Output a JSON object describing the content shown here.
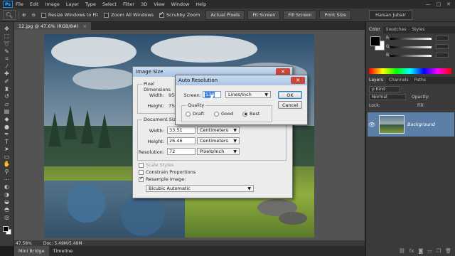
{
  "app": {
    "logo": "Ps"
  },
  "menu": [
    "File",
    "Edit",
    "Image",
    "Layer",
    "Type",
    "Select",
    "Filter",
    "3D",
    "View",
    "Window",
    "Help"
  ],
  "window_controls": [
    "—",
    "□",
    "✕"
  ],
  "options": {
    "resize_windows": "Resize Windows to Fit",
    "zoom_all": "Zoom All Windows",
    "scrubby_zoom": "Scrubby Zoom",
    "actual_pixels": "Actual Pixels",
    "fit_screen": "Fit Screen",
    "fill_screen": "Fill Screen",
    "print_size": "Print Size",
    "user": "Haisan Jubair"
  },
  "document_tab": {
    "title": "12.jpg @ 47.6% (RGB/8#)",
    "close": "×"
  },
  "status": {
    "zoom": "47.58%",
    "doc": "Doc: 5.49M/5.49M"
  },
  "bottom_tabs": [
    "Mini Bridge",
    "Timeline"
  ],
  "panels": {
    "color_tabs": [
      "Color",
      "Swatches",
      "Styles"
    ],
    "sliders": [
      "R",
      "G",
      "B"
    ],
    "layer_tabs": [
      "Layers",
      "Channels",
      "Paths"
    ],
    "kind": "ρ Kind",
    "blend_mode": "Normal",
    "opacity_label": "Opacity:",
    "lock_label": "Lock:",
    "fill_label": "Fill:",
    "layer_name": "Background"
  },
  "image_size": {
    "title": "Image Size",
    "close": "✕",
    "pixel_dimensions": "Pixel Dimensions",
    "width_label": "Width:",
    "width_value": "950",
    "height_label": "Height:",
    "height_value": "756",
    "document_size": "Document Size:",
    "doc_width_label": "Width:",
    "doc_width_value": "33.51",
    "doc_width_unit": "Centimeters",
    "doc_height_label": "Height:",
    "doc_height_value": "26.46",
    "doc_height_unit": "Centimeters",
    "resolution_label": "Resolution:",
    "resolution_value": "72",
    "resolution_unit": "Pixels/Inch",
    "scale_styles": "Scale Styles",
    "constrain": "Constrain Proportions",
    "resample": "Resample Image:",
    "resample_method": "Bicubic Automatic"
  },
  "auto_resolution": {
    "title": "Auto Resolution",
    "close": "✕",
    "screen_label": "Screen:",
    "screen_value": "133",
    "screen_unit": "Lines/Inch",
    "quality_label": "Quality",
    "draft": "Draft",
    "good": "Good",
    "best": "Best",
    "ok": "OK",
    "cancel": "Cancel"
  },
  "tools": [
    "move-icon",
    "marquee-icon",
    "lasso-icon",
    "quick-select-icon",
    "crop-icon",
    "eyedropper-icon",
    "healing-icon",
    "brush-icon",
    "clone-stamp-icon",
    "history-brush-icon",
    "eraser-icon",
    "gradient-icon",
    "blur-icon",
    "dodge-icon",
    "pen-icon",
    "type-icon",
    "path-select-icon",
    "shape-icon",
    "hand-icon",
    "zoom-icon",
    "zoom-icon-2",
    "extra-icon-1",
    "extra-icon-2",
    "extra-icon-3",
    "extra-icon-4",
    "extra-icon-5",
    "quick-mask-icon",
    "screen-mode-icon"
  ]
}
